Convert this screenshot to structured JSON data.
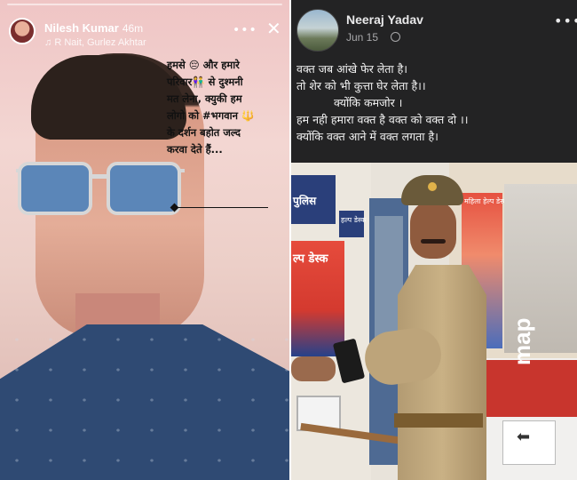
{
  "story": {
    "user_name": "Nilesh Kumar",
    "time_ago": "46m",
    "music": "R Nait, Gurlez Akhtar",
    "more_icon": "more-horizontal-icon",
    "close_icon": "close-icon",
    "text_lines": [
      "हमसे 😔 और हमारे",
      "परिवार👫 से दुश्मनी",
      "मत लेना, क्युकी हम",
      "लोगो को #भगवान 🔱",
      "के दर्शन बहोत जल्द",
      "करवा देते हैं..."
    ]
  },
  "post": {
    "user_name": "Neeraj Yadav",
    "date": "Jun 15",
    "visibility_icon": "globe-icon",
    "more_icon": "more-horizontal-icon",
    "lines": [
      {
        "text": "वक्त जब आंखे फेर लेता है।",
        "indent": false
      },
      {
        "text": "तो शेर को भी कुत्ता घेर लेता है।।",
        "indent": false
      },
      {
        "text": "क्योंकि कमजोर ।",
        "indent": true
      },
      {
        "text": "हम नही हमारा वक्त है वक्त को वक्त दो ।।",
        "indent": false
      },
      {
        "text": "क्योंकि वक्त आने में वक्त लगता है।",
        "indent": false
      }
    ],
    "photo": {
      "sign_text": "पुलिस",
      "small_sign_text": "हल्प डेस्क",
      "poster_text": "ल्प डेस्क",
      "right_poster_text": "महिला हेल्प डेस्क",
      "banner_text": "map"
    }
  }
}
